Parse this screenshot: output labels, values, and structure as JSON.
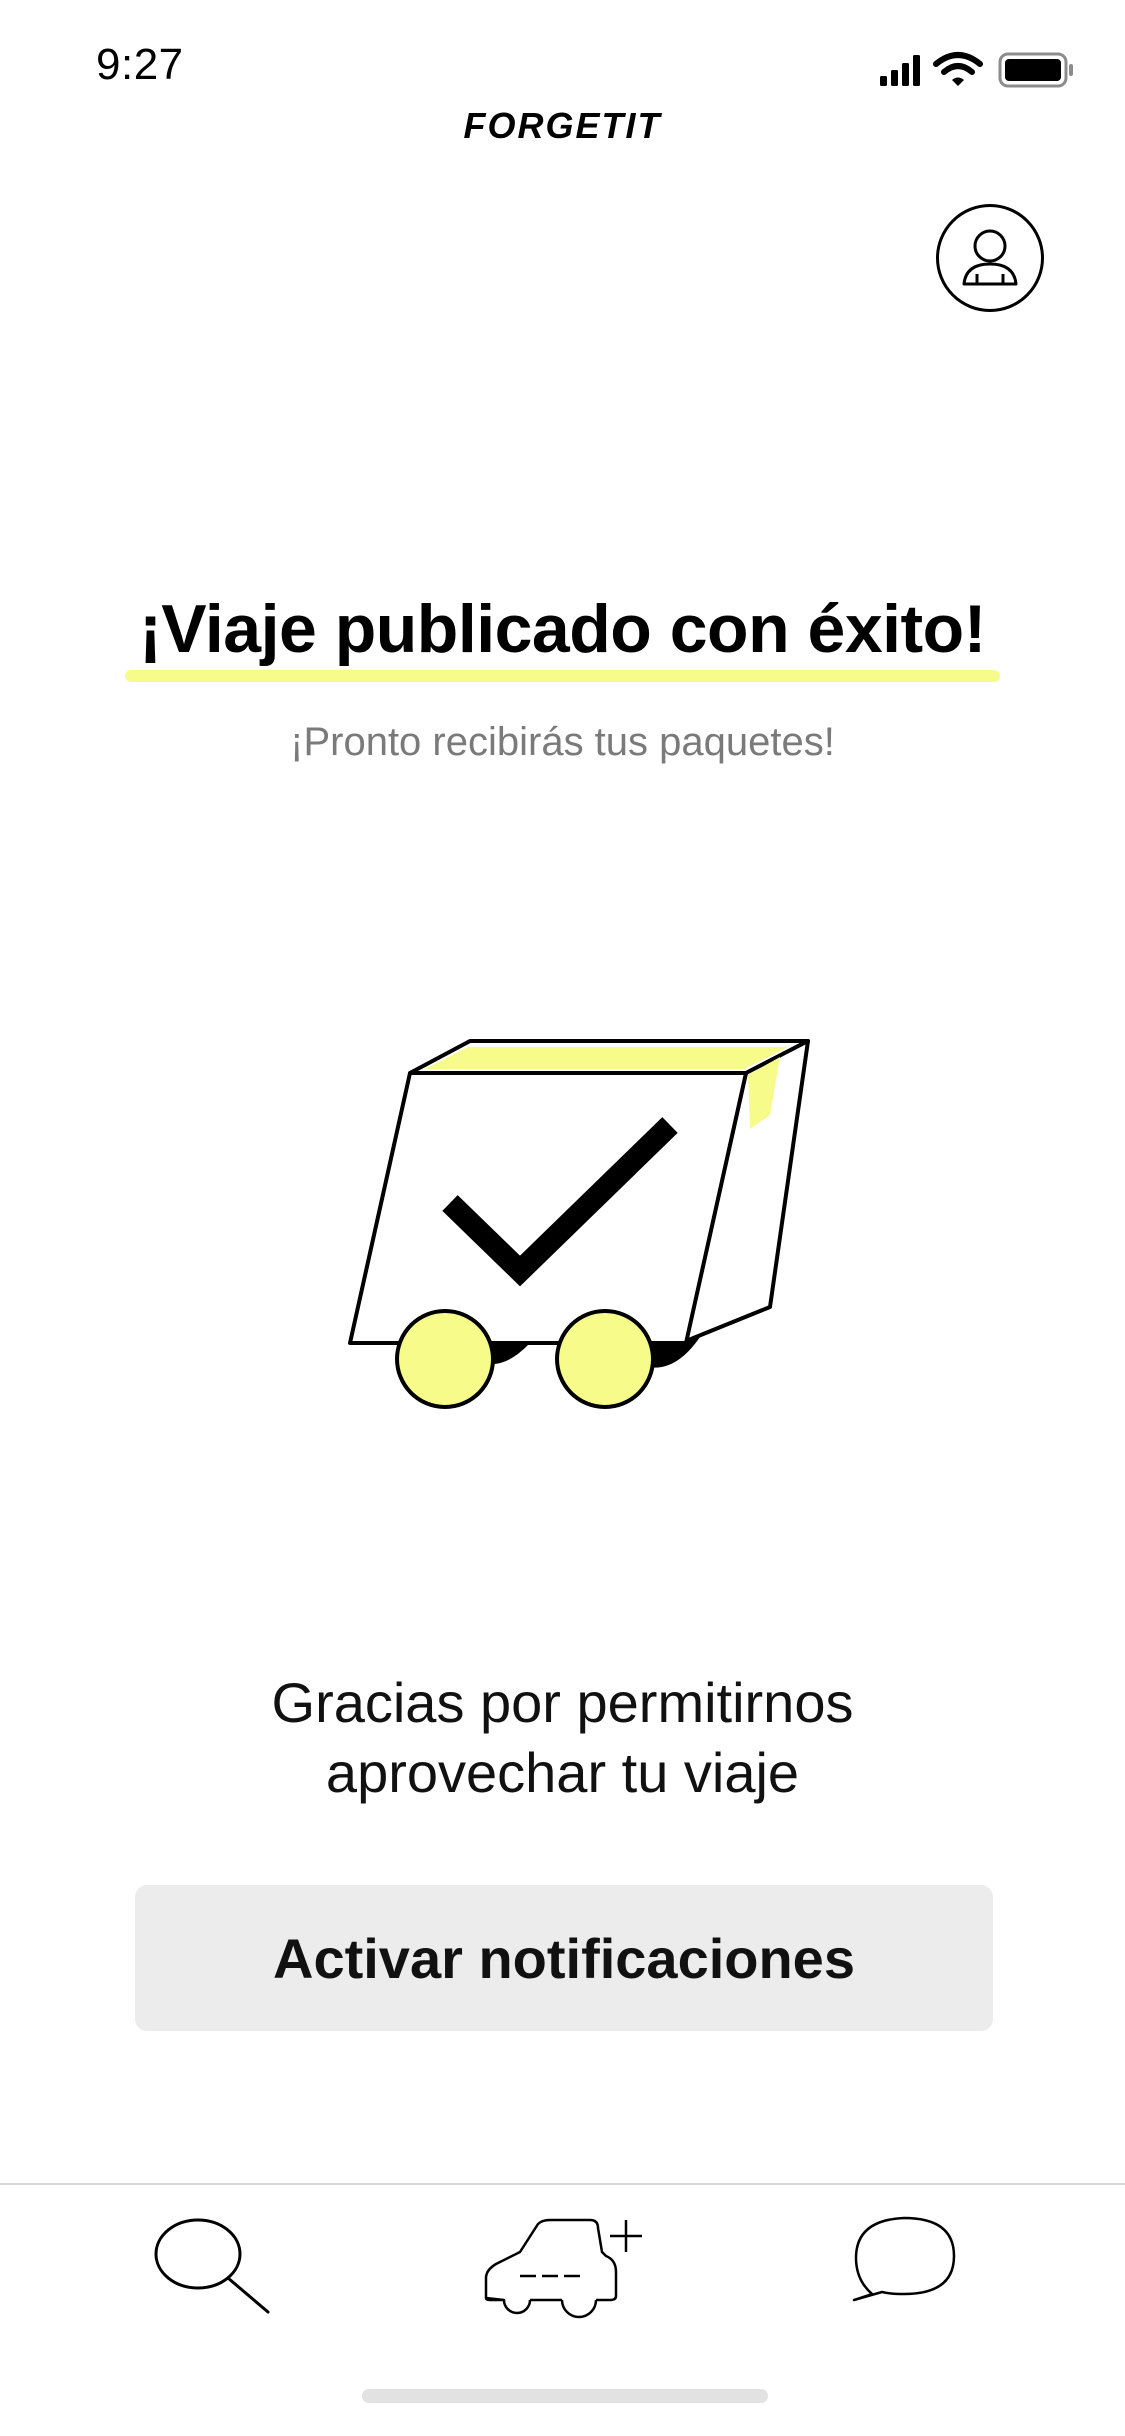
{
  "status_bar": {
    "time": "9:27",
    "icons": [
      "cellular-signal-icon",
      "wifi-icon",
      "battery-icon"
    ]
  },
  "header": {
    "brand": "FORGETIT",
    "profile_icon": "user-profile-icon"
  },
  "main": {
    "headline": "¡Viaje publicado con éxito!",
    "subtitle": "¡Pronto recibirás tus paquetes!",
    "illustration": "package-delivered-checkmark",
    "thanks_bold": "Gracias",
    "thanks_line1_rest": " por permitirnos",
    "thanks_line2": "aprovechar tu viaje",
    "button_label": "Activar notificaciones"
  },
  "tab_bar": {
    "items": [
      {
        "icon": "search-icon"
      },
      {
        "icon": "car-add-icon"
      },
      {
        "icon": "chat-bubble-icon"
      }
    ]
  },
  "colors": {
    "accent_yellow": "#f6fb8a",
    "button_bg": "#ececec",
    "subtitle_gray": "#7a7a7a"
  }
}
